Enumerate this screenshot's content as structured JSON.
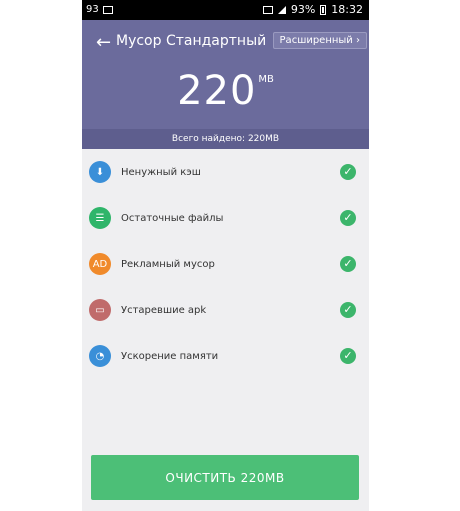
{
  "status": {
    "left_text": "93",
    "right_text": "93%",
    "time": "18:32"
  },
  "header": {
    "back_icon": "←",
    "title": "Мусор Стандартный",
    "advanced_button": "Расширенный ›",
    "size_value": "220",
    "size_unit": "MB"
  },
  "summary": {
    "found_text": "Всего найдено: 220MB"
  },
  "items": [
    {
      "label": "Ненужный кэш",
      "icon": "download-box-icon",
      "color": "#3a8fd8",
      "glyph": "⬇"
    },
    {
      "label": "Остаточные файлы",
      "icon": "document-icon",
      "color": "#2fb56a",
      "glyph": "☰"
    },
    {
      "label": "Рекламный мусор",
      "icon": "ad-icon",
      "color": "#f08a2b",
      "glyph": "AD"
    },
    {
      "label": "Устаревшие apk",
      "icon": "folder-icon",
      "color": "#c06b6b",
      "glyph": "▭"
    },
    {
      "label": "Ускорение памяти",
      "icon": "speed-icon",
      "color": "#3a8fd8",
      "glyph": "◔"
    }
  ],
  "button": {
    "label": "ОЧИСТИТЬ 220MB"
  }
}
